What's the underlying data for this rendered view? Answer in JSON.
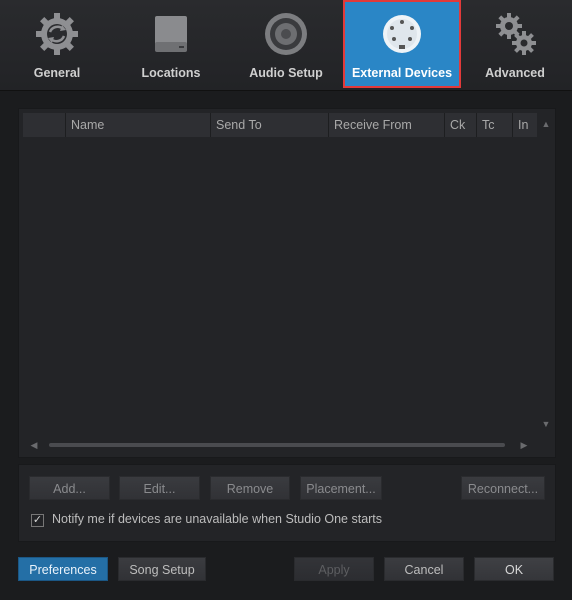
{
  "tabs": [
    {
      "label": "General",
      "icon": "sync-gear-icon"
    },
    {
      "label": "Locations",
      "icon": "hard-drive-icon"
    },
    {
      "label": "Audio Setup",
      "icon": "speaker-icon"
    },
    {
      "label": "External Devices",
      "icon": "midi-din-icon",
      "active": true
    },
    {
      "label": "Advanced",
      "icon": "gears-icon"
    }
  ],
  "table": {
    "columns": [
      "",
      "Name",
      "Send To",
      "Receive From",
      "Ck",
      "Tc",
      "In"
    ],
    "rows": []
  },
  "actions": {
    "add": "Add...",
    "edit": "Edit...",
    "remove": "Remove",
    "placement": "Placement...",
    "reconnect": "Reconnect..."
  },
  "notify": {
    "checked": true,
    "label": "Notify me if devices are unavailable when Studio One starts"
  },
  "footer": {
    "preferences": "Preferences",
    "song_setup": "Song Setup",
    "apply": "Apply",
    "cancel": "Cancel",
    "ok": "OK"
  },
  "colors": {
    "accent": "#2a86c6",
    "selection_outline": "#e23a3a",
    "background": "#1b1c1e"
  }
}
